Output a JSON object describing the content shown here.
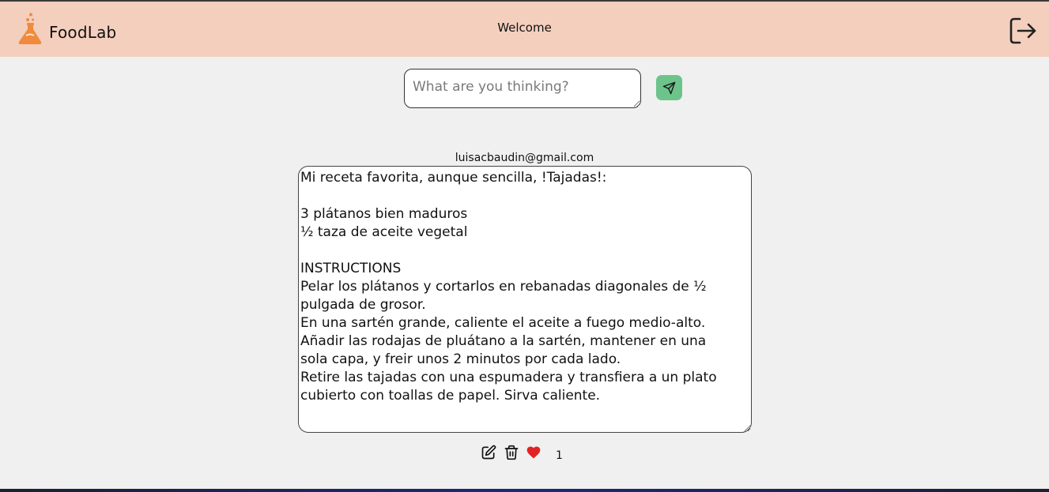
{
  "header": {
    "brand": "FoodLab",
    "welcome": "Welcome",
    "logo_icon": "flask-icon",
    "logout_icon": "logout-icon"
  },
  "composer": {
    "placeholder": "What are you thinking?",
    "value": "",
    "send_icon": "send-icon"
  },
  "post": {
    "author": "luisacbaudin@gmail.com",
    "content": "Mi receta favorita, aunque sencilla, !Tajadas!:\n\n3 plátanos bien maduros\n½ taza de aceite vegetal\n\nINSTRUCTIONS\nPelar los plátanos y cortarlos en rebanadas diagonales de ½\npulgada de grosor.\nEn una sartén grande, caliente el aceite a fuego medio-alto.\nAñadir las rodajas de pluátano a la sartén, mantener en una\nsola capa, y freir unos 2 minutos por cada lado.\nRetire las tajadas con una espumadera y transfiera a un plato\ncubierto con toallas de papel. Sirva caliente.",
    "like_count": "1",
    "edit_icon": "edit-icon",
    "delete_icon": "trash-icon",
    "like_icon": "heart-icon"
  },
  "colors": {
    "header_bg": "#f4cfbd",
    "logo_orange": "#f08a3c",
    "send_green": "#6cc48b",
    "heart_red": "#e02424",
    "page_bg": "#f0f0f0"
  }
}
